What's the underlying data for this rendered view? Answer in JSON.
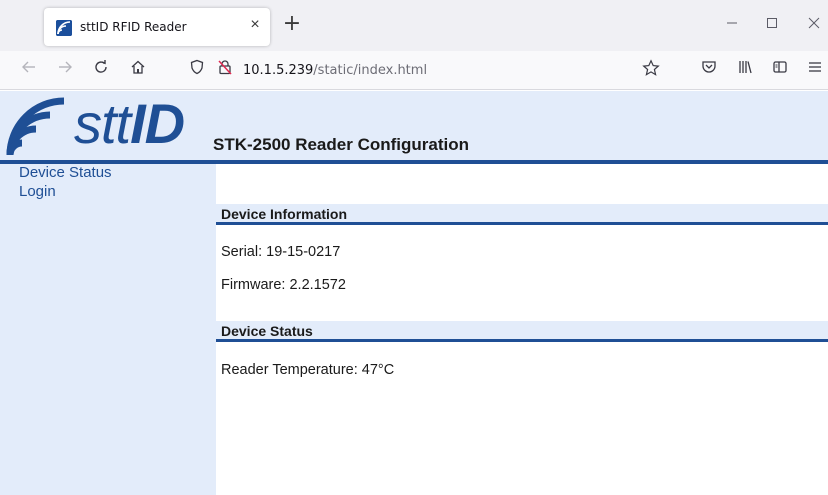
{
  "browser": {
    "tab_title": "sttID RFID Reader",
    "tab_close": "×",
    "new_tab": "+",
    "url_host": "10.1.5.239",
    "url_path": "/static/index.html",
    "window_buttons": {
      "minimize": "—",
      "maximize": "☐",
      "close": "✕"
    }
  },
  "header": {
    "logo_text_light": "stt",
    "logo_text_bold": "ID",
    "title": "STK-2500 Reader Configuration"
  },
  "sidebar": {
    "items": [
      {
        "label": "Device Status"
      },
      {
        "label": "Login"
      }
    ]
  },
  "main": {
    "device_information": {
      "heading": "Device Information",
      "serial": "Serial: 19-15-0217",
      "firmware": "Firmware: 2.2.1572"
    },
    "device_status": {
      "heading": "Device Status",
      "temperature": "Reader Temperature: 47°C"
    }
  },
  "colors": {
    "brand_blue": "#1f4f95",
    "panel_bg": "#e3ecfa"
  }
}
